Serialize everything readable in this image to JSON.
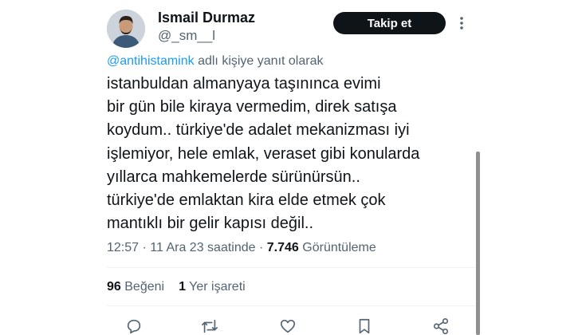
{
  "author": {
    "name": "Ismail Durmaz",
    "handle": "@_sm__l"
  },
  "follow_button": {
    "label": "Takip et"
  },
  "reply_context": {
    "mention": "@antihistamink",
    "suffix": " adlı kişiye yanıt olarak"
  },
  "tweet": {
    "lines": [
      "istanbuldan almanyaya taşınınca evimi",
      "bir gün bile kiraya vermedim, direk satışa",
      "koydum.. türkiye'de adalet mekanizması iyi",
      "işlemiyor, hele emlak, veraset gibi konularda",
      "yıllarca mahkemelerde sürünürsün..",
      "türkiye'de emlaktan kira elde etmek çok",
      "mantıklı bir gelir kapısı değil.."
    ]
  },
  "meta": {
    "time": "12:57",
    "separator": "·",
    "date": "11 Ara 23 saatinde",
    "views_count": "7.746",
    "views_label": "Görüntüleme"
  },
  "stats": {
    "likes_count": "96",
    "likes_label": "Beğeni",
    "bookmarks_count": "1",
    "bookmarks_label": "Yer işareti"
  },
  "icons": {
    "more": "more-dots-vertical-icon",
    "reply": "reply-bubble-icon",
    "retweet": "retweet-icon",
    "like": "heart-icon",
    "bookmark": "bookmark-icon",
    "share": "share-icon"
  },
  "colors": {
    "text": "#0f1419",
    "secondary": "#536471",
    "link": "#1d9bf0",
    "button_bg": "#0f1419",
    "button_text": "#ffffff"
  }
}
